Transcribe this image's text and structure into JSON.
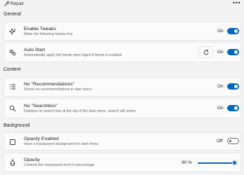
{
  "app": {
    "title": "Repair",
    "more_label": "•••"
  },
  "sections": {
    "general": "General",
    "content": "Content",
    "background": "Background"
  },
  "tweaks": {
    "enable_tweaks": {
      "title": "Enable Tweaks",
      "description": "Make the following tweaks live",
      "state": "On"
    },
    "auto_start": {
      "title": "Auto Start",
      "description": "Automatically apply the tweak upon logon if tweak is enabled",
      "state": "On"
    },
    "no_recommendations": {
      "title": "No \"Recommendations\"",
      "description": "Shows no recommendations in start menu",
      "state": "On"
    },
    "no_searchbox": {
      "title": "No \"Searchbox\"",
      "description": "Displays no search box at the top of the start menu, search still works",
      "state": "On"
    },
    "opacity_enabled": {
      "title": "Opacity Enabled",
      "description": "Have a transparent background for start menu",
      "state": "Off"
    },
    "opacity": {
      "title": "Opacity",
      "description": "Controls the transparent level in percentage",
      "value_label": "90 %",
      "value": 0.9
    }
  },
  "colors": {
    "accent": "#0067c0",
    "background": "#f3f3f3",
    "card": "#fbfbfb"
  },
  "icons": [
    "wrench-icon",
    "sparkle-icon",
    "gears-icon",
    "list-icon",
    "search-icon",
    "square-icon",
    "opacity-icon",
    "refresh-icon",
    "more-icon"
  ]
}
